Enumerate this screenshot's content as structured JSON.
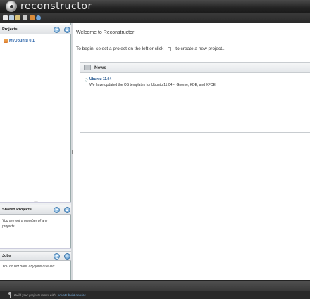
{
  "app": {
    "title": "reconstructor"
  },
  "toolbar": {
    "icons": [
      {
        "name": "new-file-icon",
        "color": "#e8e8e8"
      },
      {
        "name": "upload-icon",
        "color": "#b9cde0"
      },
      {
        "name": "folder-icon",
        "color": "#d9c27a"
      },
      {
        "name": "people-icon",
        "color": "#c9c9c9"
      },
      {
        "name": "package-icon",
        "color": "#d98b3a"
      },
      {
        "name": "globe-icon",
        "color": "#6fa3d8"
      }
    ]
  },
  "sidebar": {
    "projects": {
      "title": "Projects",
      "items": [
        {
          "label": "MyUbuntu 0.1"
        }
      ]
    },
    "shared_projects": {
      "title": "Shared Projects",
      "empty_message": "You are not a member of any projects."
    },
    "jobs": {
      "title": "Jobs",
      "empty_message": "You do not have any jobs queued."
    }
  },
  "main": {
    "welcome": "Welcome to Reconstructor!",
    "intro_before": "To begin, select a project on the left or click",
    "intro_after": "to create a new project...",
    "news": {
      "title": "News",
      "items": [
        {
          "title": "Ubuntu 11.04",
          "text": "We have updated the OS templates for Ubuntu 11.04 -- Gnome, KDE, and XFCE."
        }
      ]
    }
  },
  "footer": {
    "text": "Build your projects faster with",
    "link": "private build service"
  }
}
